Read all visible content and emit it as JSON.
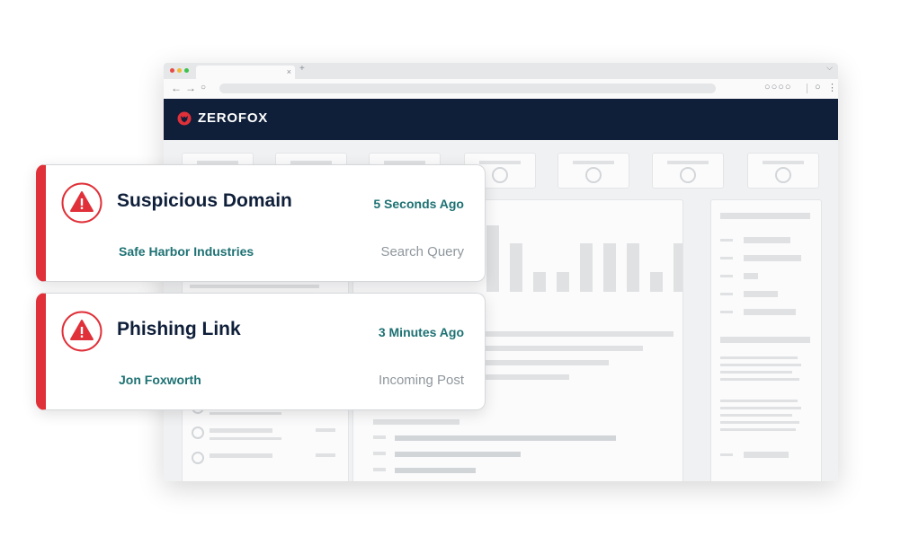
{
  "browser": {
    "tab_close": "×",
    "new_tab": "+",
    "window_chevron": "⌵",
    "nav_back": "←",
    "nav_forward": "→",
    "nav_reload": "○",
    "extensions": "○○○○",
    "toolbar_icon": "○",
    "menu_icon": "⋮"
  },
  "header": {
    "brand": "ZEROFOX",
    "colors": {
      "header_bg": "#0f1f3a",
      "logo_red": "#e03039"
    }
  },
  "alerts": [
    {
      "title": "Suspicious Domain",
      "time": "5 Seconds Ago",
      "target": "Safe Harbor Industries",
      "source": "Search Query",
      "icon": "warning-triangle-icon"
    },
    {
      "title": "Phishing Link",
      "time": "3 Minutes Ago",
      "target": "Jon Foxworth",
      "source": "Incoming Post",
      "icon": "warning-triangle-icon"
    }
  ],
  "colors": {
    "alert_accent": "#e03039",
    "title_text": "#0f1f3a",
    "teal_text": "#1e7173",
    "muted_text": "#8f979c"
  }
}
